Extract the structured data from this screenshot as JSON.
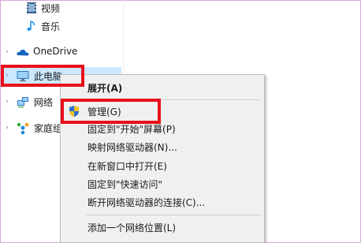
{
  "nav": {
    "videos": "视频",
    "music": "音乐",
    "onedrive": "OneDrive",
    "this_pc": "此电脑",
    "network": "网络",
    "homegroup": "家庭组"
  },
  "context_menu": {
    "expand": "展开(A)",
    "manage": "管理(G)",
    "pin_start": "固定到\"开始\"屏幕(P)",
    "map_drive": "映射网络驱动器(N)...",
    "open_new_window": "在新窗口中打开(E)",
    "pin_quick_access": "固定到\"快速访问\"",
    "disconnect_drive": "断开网络驱动器的连接(C)...",
    "add_network_location": "添加一个网络位置(L)"
  },
  "colors": {
    "highlight_box": "#e8101a",
    "selection": "#cce8ff",
    "menu_bg": "#f0f0f0"
  }
}
